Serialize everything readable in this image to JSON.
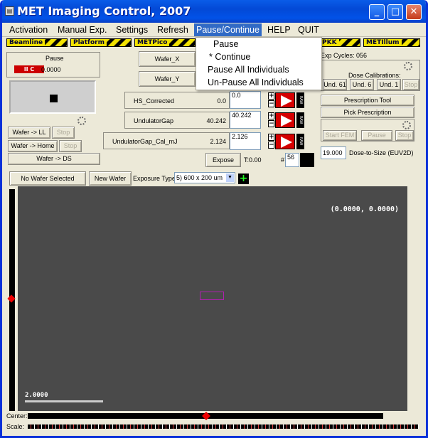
{
  "window": {
    "title": "MET Imaging Control, 2007",
    "icon": "app-icon",
    "controls": [
      "_",
      "□",
      "X"
    ]
  },
  "menu": [
    "Activation",
    "Manual Exp.",
    "Settings",
    "Refresh",
    "Pause/Continue",
    "HELP",
    "QUIT"
  ],
  "strip": [
    "Beamline",
    "Platform",
    "METPico",
    "PKK",
    "METIllum"
  ],
  "pause_panel": {
    "title": "Pause",
    "button": "II C",
    "value": "0.0000"
  },
  "wafer_buttons": {
    "wafer_x": "Wafer_X",
    "wafer_y": "Wafer_Y"
  },
  "rows": [
    {
      "label": "HS_Corrected",
      "value": "0.0",
      "input": "0.0"
    },
    {
      "label": "UndulatorGap",
      "value": "40.242",
      "input": "40.242"
    },
    {
      "label": "UndulatorGap_Cal_mJ",
      "value": "2.124",
      "input": "2.126"
    }
  ],
  "arrow_box": {
    "plus": "+",
    "minus": "−",
    "pause": "II",
    "c": "C",
    "raw": "RAW"
  },
  "left_controls": {
    "wafer_ll": "Wafer -> LL",
    "stop1": "Stop",
    "wafer_home": "Wafer -> Home",
    "stop2": "Stop",
    "wafer_ds": "Wafer -> DS"
  },
  "expose": {
    "button": "Expose",
    "t_label": "T:0.00",
    "hash": "#",
    "count": "56"
  },
  "exp_cycles": {
    "label": "Exp Cycles:",
    "value": "056"
  },
  "dose": {
    "title": "Dose Calibrations:",
    "und61": "Und. 61",
    "und6": "Und. 6",
    "und1": "Und. 1",
    "stop": "Stop"
  },
  "prescription": {
    "tool": "Prescription Tool",
    "pick": "Pick Prescription",
    "start_fem": "Start FEM",
    "pause": "Pause",
    "stop": "Stop"
  },
  "dose_to_size": {
    "value": "19.000",
    "label": "Dose-to-Size (EUV2D)"
  },
  "toolbar": {
    "no_wafer": "No Wafer Selected",
    "new_wafer": "New Wafer",
    "exposure_type_label": "Exposure Type",
    "exposure_type_value": "5)  600 x  200 um",
    "add": "+"
  },
  "viewer": {
    "coords": "(0.0000, 0.0000)",
    "scale": "2.0000"
  },
  "bottom": {
    "center_label": "Center:",
    "scale_label": "Scale:"
  },
  "dropdown": {
    "items": [
      "Pause",
      "* Continue",
      "Pause All Individuals",
      "Un-Pause All Individuals"
    ]
  }
}
